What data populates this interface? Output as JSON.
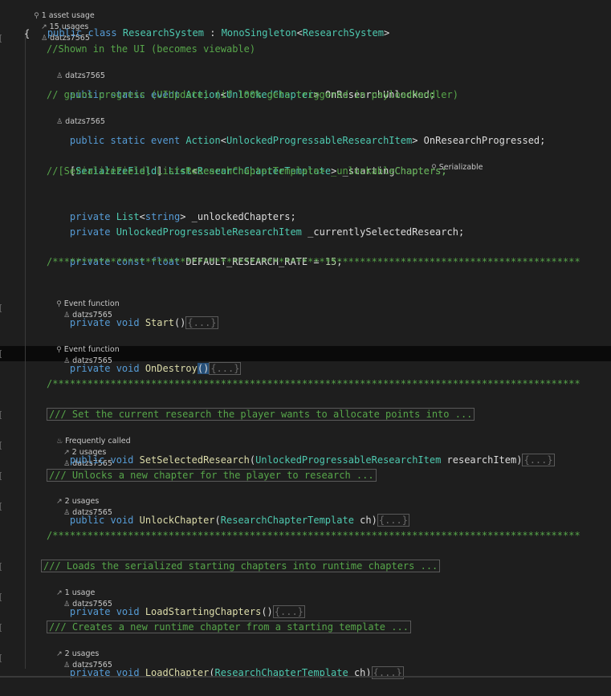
{
  "top_hint": {
    "asset_usage": "1 asset usage",
    "usages": "15 usages",
    "author": "datzs7565"
  },
  "class_line": {
    "k1": "public",
    "k2": "class",
    "name": "ResearchSystem",
    "colon": " : ",
    "base": "MonoSingleton",
    "lt": "<",
    "arg": "ResearchSystem",
    "gt": ">"
  },
  "brace_open": "{",
  "comment_ui": "//Shown in the UI (becomes viewable)",
  "hint_author_1": "datzs7565",
  "event1": {
    "mods": "public static event ",
    "type": "Action",
    "lt": "<",
    "arg": "UnlockedChapter",
    "gt": ">",
    "name": " OnResearchUnlocked;"
  },
  "comment_progress": "// gains progress (UIUpdate) (if 100% gets triggered in payloadHandler)",
  "hint_author_2": "datzs7565",
  "event2": {
    "mods": "public static event ",
    "type": "Action",
    "lt": "<",
    "arg": "UnlockedProgressableResearchItem",
    "gt": ">",
    "name": " OnResearchProgressed;"
  },
  "field_starting": {
    "attr_open": "[",
    "attr": "SerializeField",
    "attr_close": "] ",
    "type": "List",
    "lt": "<",
    "arg": "ResearchChapterTemplate",
    "gt": ">",
    "name": " _startingChapters;",
    "hint": "Serializable"
  },
  "comment_unlockable": "//[SerializeField] List<ResearchChapterTemplate> _unlockableChapters;",
  "field_unlocked": {
    "k": "private ",
    "type": "List",
    "lt": "<",
    "arg": "string",
    "gt": ">",
    "name": " _unlockedChapters;"
  },
  "field_current": {
    "k": "private ",
    "type": "UnlockedProgressableResearchItem",
    "name": " _currentlySelectedResearch;"
  },
  "const_line": {
    "k": "private const float ",
    "name": "DEFAULT_RESEARCH_RATE",
    "eq": " = ",
    "val": "15",
    "end": ";"
  },
  "separator": "/*******************************************************************************************",
  "hint_start": {
    "kind": "Event function",
    "author": "datzs7565"
  },
  "method_start": {
    "k": "private void ",
    "name": "Start",
    "paren": "()",
    "body": "{...}"
  },
  "hint_destroy": {
    "kind": "Event function",
    "author": "datzs7565"
  },
  "method_destroy": {
    "k": "private void ",
    "name": "OnDestroy",
    "paren": "()",
    "body": "{...}"
  },
  "doc_set": "/// Set the current research the player wants to allocate points into ...",
  "hint_set": {
    "kind": "Frequently called",
    "usages": "2 usages",
    "author": "datzs7565"
  },
  "method_set": {
    "k": "public void ",
    "name": "SetSelectedResearch",
    "open": "(",
    "ptype": "UnlockedProgressableResearchItem",
    "pname": " researchItem",
    "close": ")",
    "body": "{...}"
  },
  "doc_unlock": "/// Unlocks a new chapter for the player to research ...",
  "hint_unlock": {
    "usages": "2 usages",
    "author": "datzs7565"
  },
  "method_unlock": {
    "k": "public void ",
    "name": "UnlockChapter",
    "open": "(",
    "ptype": "ResearchChapterTemplate",
    "pname": " ch",
    "close": ")",
    "body": "{...}"
  },
  "doc_load": "/// Loads the serialized starting chapters into runtime chapters ...",
  "hint_load": {
    "usages": "1 usage",
    "author": "datzs7565"
  },
  "method_load": {
    "k": "private void ",
    "name": "LoadStartingChapters",
    "paren": "()",
    "body": "{...}"
  },
  "doc_create": "/// Creates a new runtime chapter from a starting template ...",
  "hint_create": {
    "usages": "2 usages",
    "author": "datzs7565"
  },
  "method_create": {
    "k": "private void ",
    "name": "LoadChapter",
    "open": "(",
    "ptype": "ResearchChapterTemplate",
    "pname": " ch",
    "close": ")",
    "body": "{...}"
  },
  "colors": {
    "background": "#1e1e1e",
    "keyword": "#569cd6",
    "type": "#4ec9b0",
    "method": "#dcdcaa",
    "comment": "#57a64a",
    "number": "#b5cea8"
  },
  "icons": [
    "asset-icon",
    "usages-icon",
    "user-icon",
    "event-function-icon",
    "flame-icon",
    "serializable-icon"
  ]
}
